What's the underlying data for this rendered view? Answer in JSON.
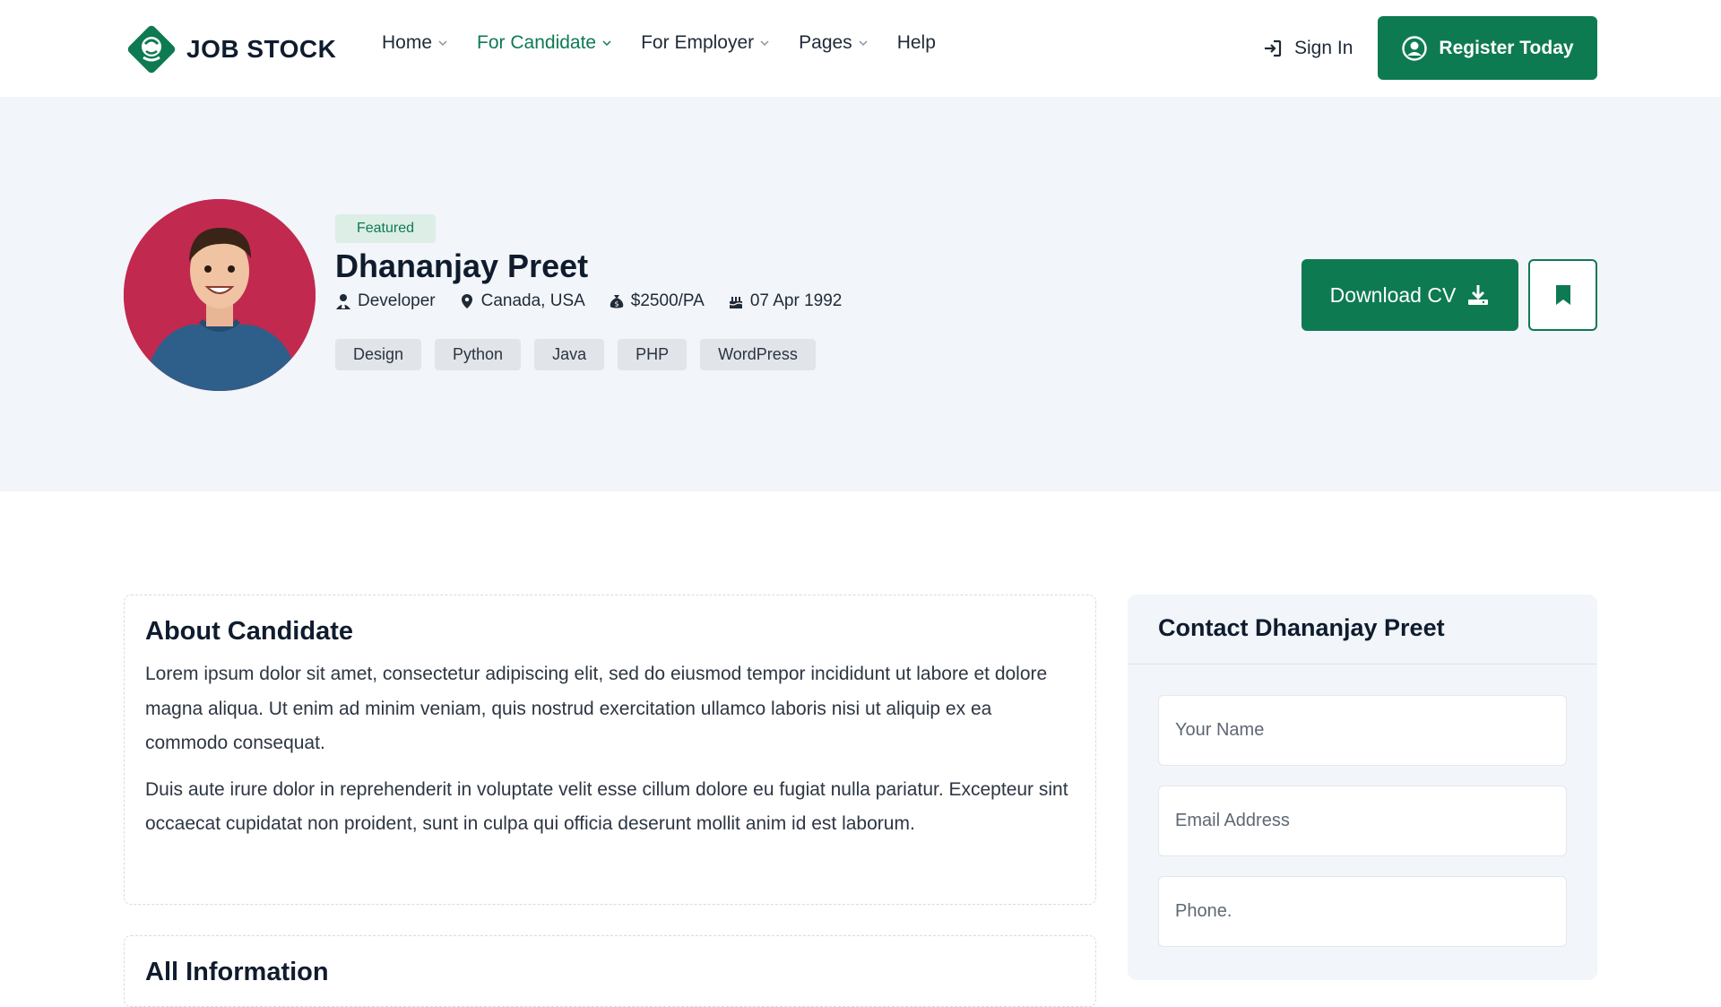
{
  "brand": {
    "name": "JOB STOCK",
    "accent_color": "#0e7a52"
  },
  "nav": {
    "items": [
      {
        "label": "Home",
        "has_dropdown": true,
        "active": false
      },
      {
        "label": "For Candidate",
        "has_dropdown": true,
        "active": true
      },
      {
        "label": "For Employer",
        "has_dropdown": true,
        "active": false
      },
      {
        "label": "Pages",
        "has_dropdown": true,
        "active": false
      },
      {
        "label": "Help",
        "has_dropdown": false,
        "active": false
      }
    ],
    "sign_in": "Sign In",
    "register": "Register Today"
  },
  "candidate": {
    "badge": "Featured",
    "name": "Dhananjay Preet",
    "role": "Developer",
    "location": "Canada, USA",
    "salary": "$2500/PA",
    "dob": "07 Apr 1992",
    "skills": [
      "Design",
      "Python",
      "Java",
      "PHP",
      "WordPress"
    ],
    "download_label": "Download CV",
    "bookmark_icon": "bookmark-icon"
  },
  "about": {
    "title": "About Candidate",
    "paragraphs": [
      "Lorem ipsum dolor sit amet, consectetur adipiscing elit, sed do eiusmod tempor incididunt ut labore et dolore magna aliqua. Ut enim ad minim veniam, quis nostrud exercitation ullamco laboris nisi ut aliquip ex ea commodo consequat.",
      "Duis aute irure dolor in reprehenderit in voluptate velit esse cillum dolore eu fugiat nulla pariatur. Excepteur sint occaecat cupidatat non proident, sunt in culpa qui officia deserunt mollit anim id est laborum."
    ]
  },
  "all_info": {
    "title": "All Information"
  },
  "contact": {
    "title": "Contact Dhananjay Preet",
    "name_placeholder": "Your Name",
    "email_placeholder": "Email Address",
    "phone_placeholder": "Phone."
  }
}
